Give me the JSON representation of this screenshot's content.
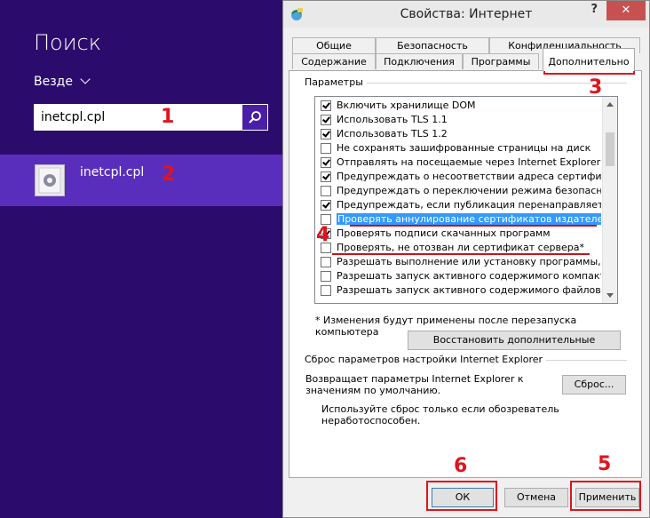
{
  "charm": {
    "title": "Поиск",
    "scope": "Везде",
    "search_value": "inetcpl.cpl",
    "result_label": "inetcpl.cpl",
    "icons": {
      "search": "magnifier-icon",
      "result": "control-panel-file-icon",
      "scope": "chevron-down-icon"
    }
  },
  "dialog": {
    "title": "Свойства: Интернет",
    "help": "?",
    "close": "✕",
    "tabs_top": [
      "Общие",
      "Безопасность",
      "Конфиденциальность"
    ],
    "tabs_bottom": [
      "Содержание",
      "Подключения",
      "Программы",
      "Дополнительно"
    ],
    "active_tab": "Дополнительно",
    "params_label": "Параметры",
    "settings": [
      {
        "label": "Включить хранилище DOM",
        "checked": true,
        "selected": false
      },
      {
        "label": "Использовать TLS 1.1",
        "checked": true,
        "selected": false
      },
      {
        "label": "Использовать TLS 1.2",
        "checked": true,
        "selected": false
      },
      {
        "label": "Не сохранять зашифрованные страницы на диск",
        "checked": false,
        "selected": false
      },
      {
        "label": "Отправлять на посещаемые через Internet Explorer ве",
        "checked": true,
        "selected": false
      },
      {
        "label": "Предупреждать о несоответствии адреса сертификат",
        "checked": true,
        "selected": false
      },
      {
        "label": "Предупреждать о переключении режима безопасност",
        "checked": false,
        "selected": false
      },
      {
        "label": "Предупреждать, если публикация перенаправляется",
        "checked": true,
        "selected": false
      },
      {
        "label": "Проверять аннулирование сертификатов издателей",
        "checked": false,
        "selected": true
      },
      {
        "label": "Проверять подписи скачанных программ",
        "checked": true,
        "selected": false
      },
      {
        "label": "Проверять, не отозван ли сертификат сервера*",
        "checked": false,
        "selected": false
      },
      {
        "label": "Разрешать выполнение или установку программы, име",
        "checked": false,
        "selected": false
      },
      {
        "label": "Разрешать запуск активного содержимого компакт-ди",
        "checked": false,
        "selected": false
      },
      {
        "label": "Разрешать запуск активного содержимого файлов на",
        "checked": false,
        "selected": false
      }
    ],
    "restart_note": "* Изменения будут применены после перезапуска компьютера",
    "restore_button": "Восстановить дополнительные параметры",
    "reset_section_label": "Сброс параметров настройки Internet Explorer",
    "reset_description": "Возвращает параметры Internet Explorer к значениям по умолчанию.",
    "reset_button": "Сброс...",
    "reset_note": "Используйте сброс только если обозреватель неработоспособен.",
    "ok_button": "ОК",
    "cancel_button": "Отмена",
    "apply_button": "Применить"
  },
  "annotations": {
    "step1": "1",
    "step2": "2",
    "step3": "3",
    "step4": "4",
    "step5": "5",
    "step6": "6",
    "color": "#e0141e"
  }
}
